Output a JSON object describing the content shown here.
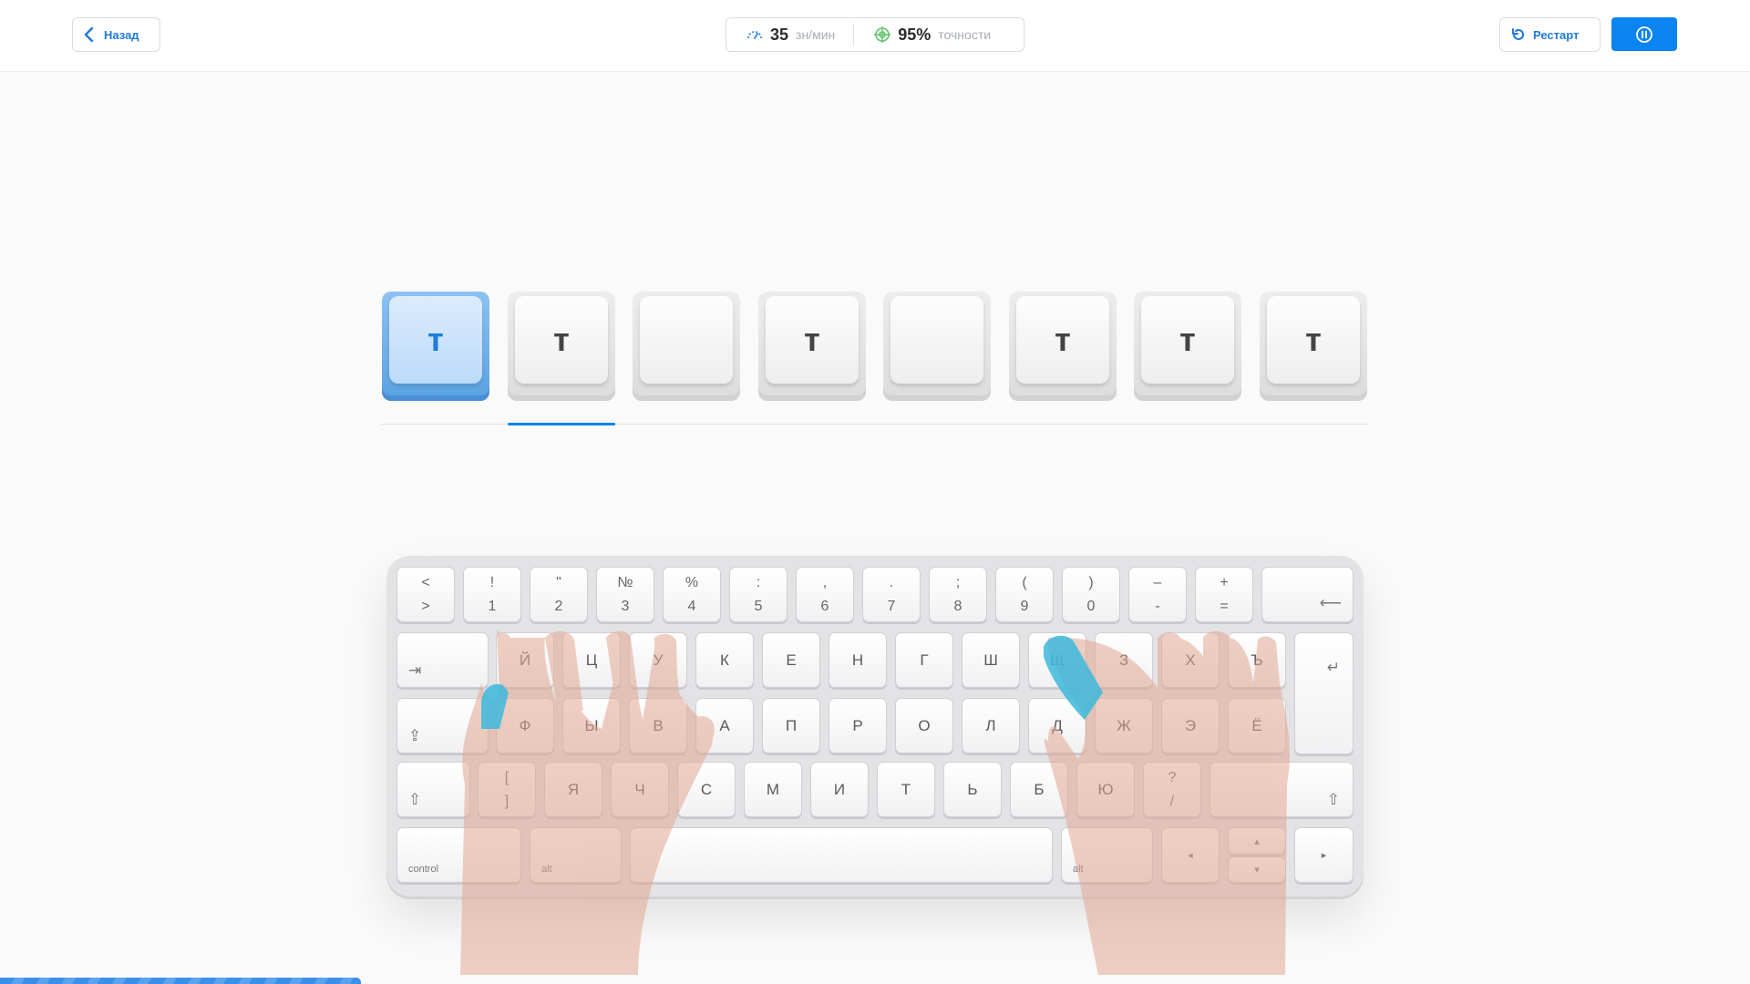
{
  "header": {
    "back_label": "Назад",
    "speed_value": "35",
    "speed_unit": "зн/мин",
    "accuracy_value": "95%",
    "accuracy_unit": "точности",
    "restart_label": "Рестарт"
  },
  "letters": [
    "т",
    "т",
    "",
    "т",
    "",
    "т",
    "т",
    "т"
  ],
  "active_letter_index": 0,
  "progress_fraction": 0.21,
  "keyboard": {
    "row1": [
      [
        "<",
        ">"
      ],
      [
        "!",
        "1"
      ],
      [
        "\"",
        "2"
      ],
      [
        "№",
        "3"
      ],
      [
        "%",
        "4"
      ],
      [
        ":",
        "5"
      ],
      [
        ",",
        "6"
      ],
      [
        ".",
        "7"
      ],
      [
        ";",
        "8"
      ],
      [
        "(",
        "9"
      ],
      [
        ")",
        "0"
      ],
      [
        "–",
        "-"
      ],
      [
        "+",
        "="
      ]
    ],
    "row2": [
      "Й",
      "Ц",
      "У",
      "К",
      "Е",
      "Н",
      "Г",
      "Ш",
      "Щ",
      "З",
      "Х",
      "Ъ"
    ],
    "row3": [
      "Ф",
      "Ы",
      "В",
      "А",
      "П",
      "Р",
      "О",
      "Л",
      "Д",
      "Ж",
      "Э",
      "Ё"
    ],
    "row4_bracket": [
      "[",
      "]"
    ],
    "row4": [
      "Я",
      "Ч",
      "С",
      "М",
      "И",
      "Т",
      "Ь",
      "Б",
      "Ю"
    ],
    "row4_slash": [
      "?",
      "/"
    ],
    "control_label": "control",
    "alt_label": "alt",
    "alt_right_label": "alt"
  },
  "icons": {
    "back": "chevron-left-icon",
    "speed": "speedometer-icon",
    "accuracy": "target-icon",
    "restart": "restart-icon",
    "pause": "pause-icon"
  },
  "colors": {
    "accent": "#0a84f0",
    "active_finger": "#3cb8dc",
    "hand": "#e9b9a6"
  }
}
